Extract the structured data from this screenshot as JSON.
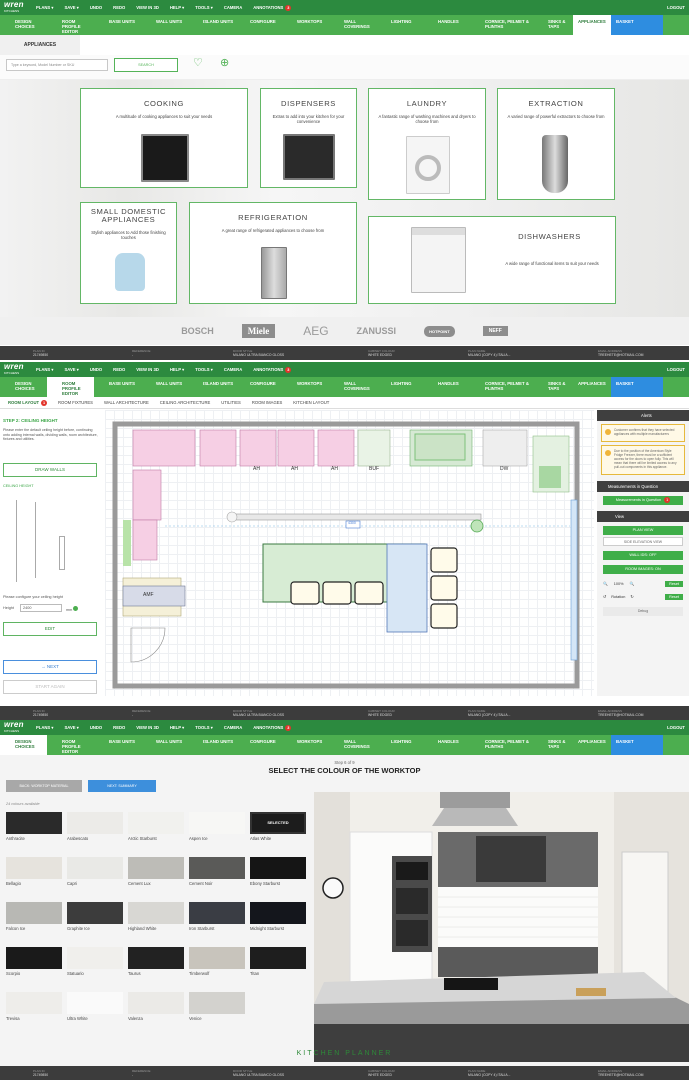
{
  "app": {
    "logo": "wren",
    "logo_sub": "KITCHENS",
    "menu": [
      "PLANS ▾",
      "SAVE ▾",
      "UNDO",
      "REDO",
      "VIEW IN 3D",
      "HELP ▾",
      "TOOLS ▾",
      "CAMERA",
      "ANNOTATIONS"
    ],
    "annotations_count": "3",
    "logout": "LOGOUT"
  },
  "nav": [
    {
      "label": "DESIGN CHOICES"
    },
    {
      "label": "ROOM PROFILE EDITOR"
    },
    {
      "label": "BASE UNITS"
    },
    {
      "label": "WALL UNITS"
    },
    {
      "label": "ISLAND UNITS"
    },
    {
      "label": "CONFIGURE"
    },
    {
      "label": "WORKTOPS"
    },
    {
      "label": "WALL COVERINGS"
    },
    {
      "label": "LIGHTING"
    },
    {
      "label": "HANDLES"
    },
    {
      "label": "CORNICE, PELMET & PLINTHS"
    },
    {
      "label": "SINKS & TAPS"
    },
    {
      "label": "APPLIANCES"
    },
    {
      "label": "BASKET"
    }
  ],
  "footer": {
    "plan_id_label": "PLAN ID",
    "plan_id": "21749850",
    "reference_label": "REFERENCE",
    "reference": "-",
    "door_style_label": "DOOR STYLE",
    "door_style": "MILANO ULTRA BIANCO GLOSS",
    "cabinet_colour_label": "CABINET COLOUR",
    "cabinet_colour": "WHITE EDGED",
    "plan_name_label": "PLAN NAME",
    "plan_name": "MILANO (COPY 4) ITALIA...",
    "email_label": "EMAIL ADDRESS",
    "email": "TREEHETE@HOTMAIL.COM"
  },
  "appliances": {
    "tab": "APPLIANCES",
    "search_placeholder": "Type a keyword, Model Number or SKU",
    "search_button": "SEARCH",
    "categories": [
      {
        "title": "COOKING",
        "desc": "A multitude of cooking appliances to suit your needs"
      },
      {
        "title": "DISPENSERS",
        "desc": "Extras to add into your kitchen for your convenience"
      },
      {
        "title": "LAUNDRY",
        "desc": "A fantastic range of washing machines and dryers to choose from"
      },
      {
        "title": "EXTRACTION",
        "desc": "A varied range of powerful extractors to choose from"
      },
      {
        "title": "SMALL DOMESTIC APPLIANCES",
        "desc": "Stylish appliances to Add those finishing touches"
      },
      {
        "title": "REFRIGERATION",
        "desc": "A great range of refrigerated appliances to choose from"
      },
      {
        "title": "DISHWASHERS",
        "desc": "A wide range of functional items to suit your needs"
      }
    ],
    "brands": [
      "BOSCH",
      "Miele",
      "AEG",
      "ZANUSSI",
      "HOTPOINT",
      "NEFF"
    ]
  },
  "room": {
    "tabs": [
      "ROOM LAYOUT",
      "ROOM FIXTURES",
      "WALL ARCHITECTURE",
      "CEILING ARCHITECTURE",
      "UTILITIES",
      "ROOM IMAGES",
      "KITCHEN LAYOUT"
    ],
    "step_title": "STEP 2: CEILING HEIGHT",
    "step_desc": "Please enter the default ceiling height before, continuing onto adding internal walls, dividing walls, room architecture, fixtures and utilities.",
    "draw_walls": "DRAW WALLS",
    "ceiling_height_label": "CEILING HEIGHT",
    "configure_text": "Please configure your ceiling height",
    "height_label": "Height",
    "height_value": "2400",
    "height_unit": "mm",
    "edit": "EDIT",
    "next": "→ NEXT",
    "start_again": "START AGAIN",
    "unit_labels": [
      "AH",
      "AH",
      "AH",
      "BUF",
      "DW",
      "AMF"
    ],
    "dimension": "4300",
    "alerts_title": "Alerts",
    "alerts": [
      "Customer confirms that they have selected appliances with multiple manufacturers",
      "Due to the position of the American Style Fridge Freezer, there must be a sufficient access for the doors to open fully. This will mean that there will be limited access to any pull-out components in this appliance."
    ],
    "measurements_title": "Measurements in Question",
    "measurements_button": "Measurements in Question",
    "measurements_count": "1",
    "view_title": "View",
    "plan_view": "PLAN VIEW",
    "side_elevation": "SIDE ELEVATION VIEW",
    "wall_ids": "WALL IDS: OFF",
    "room_images": "ROOM IMAGES: ON",
    "zoom": "100%",
    "reset": "Reset",
    "rotation": "Rotation",
    "debug": "Debug"
  },
  "worktop": {
    "step": "Step 6 of 9",
    "title": "SELECT THE COLOUR OF THE WORKTOP",
    "back_button": "BACK: WORKTOP MATERIAL",
    "next_button": "NEXT: SUMMARY",
    "count": "24 colours available",
    "selected": "SELECTED",
    "brand": "KITCHEN PLANNER",
    "colours": [
      {
        "name": "Anthracite",
        "color": "#2a2a2a"
      },
      {
        "name": "Arabescato",
        "color": "#ecebe8"
      },
      {
        "name": "Arctic Starburst",
        "color": "#f1f1ee"
      },
      {
        "name": "Aspen Ice",
        "color": "#f7f7f5"
      },
      {
        "name": "Atlas White",
        "color": "#1c1c1c"
      },
      {
        "name": "Bellagio",
        "color": "#e6e3dd"
      },
      {
        "name": "Capri",
        "color": "#e9e9e6"
      },
      {
        "name": "Cement Lux",
        "color": "#bdbcb7"
      },
      {
        "name": "Cement Noir",
        "color": "#5a5a58"
      },
      {
        "name": "Ebony Starburst",
        "color": "#151515"
      },
      {
        "name": "Falcon Ice",
        "color": "#b8b8b4"
      },
      {
        "name": "Graphite Ice",
        "color": "#3c3c3c"
      },
      {
        "name": "Highland White",
        "color": "#d8d7d3"
      },
      {
        "name": "Iron Starburst",
        "color": "#3a3d44"
      },
      {
        "name": "Midnight Starburst",
        "color": "#14161c"
      },
      {
        "name": "Scorpio",
        "color": "#1a1a1a"
      },
      {
        "name": "Statuario",
        "color": "#f0efec"
      },
      {
        "name": "Taurus",
        "color": "#222222"
      },
      {
        "name": "Timberwolf",
        "color": "#c8c4bc"
      },
      {
        "name": "Titan",
        "color": "#1e1e1e"
      },
      {
        "name": "Trevisa",
        "color": "#eeedea"
      },
      {
        "name": "Ultra White",
        "color": "#fafafa"
      },
      {
        "name": "Valenza",
        "color": "#ebeae7"
      },
      {
        "name": "Venice",
        "color": "#d3d2ce"
      }
    ]
  }
}
